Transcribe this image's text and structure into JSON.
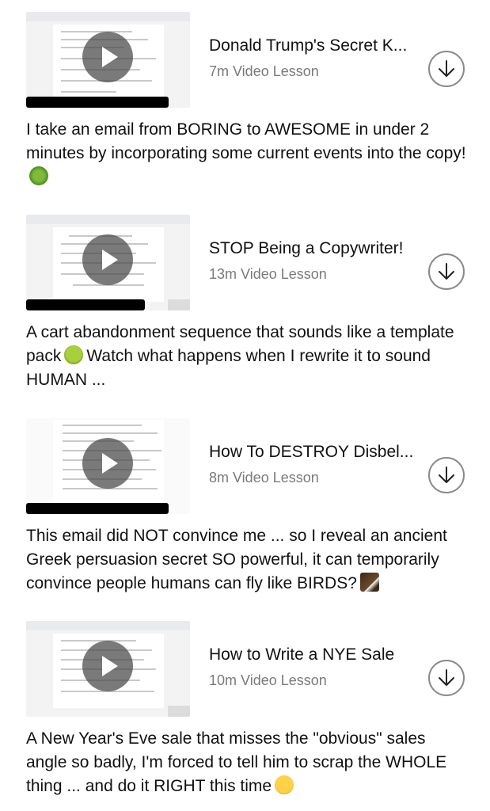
{
  "lessons": [
    {
      "title": "Donald Trump's Secret K...",
      "meta": "7m Video Lesson",
      "description": "I take an email from BORING to AWESOME in under 2 minutes by incorporating some current events into the copy!",
      "emoji_icon": "virus-icon"
    },
    {
      "title": "STOP Being a Copywriter!",
      "meta": "13m Video Lesson",
      "description_parts": [
        "A cart abandonment sequence that sounds like a template pack",
        "Watch what happens when I rewrite it to sound HUMAN ..."
      ],
      "emoji_icon": "nauseated-face-icon"
    },
    {
      "title": "How To DESTROY Disbel...",
      "meta": "8m Video Lesson",
      "description": "This email did NOT convince me ... so I reveal an ancient Greek persuasion secret SO powerful, it can temporarily convince people humans can fly like BIRDS?",
      "emoji_icon": "eagle-icon"
    },
    {
      "title": "How to Write a NYE Sale",
      "meta": "10m Video Lesson",
      "description": "A New Year's Eve sale that misses the \"obvious\" sales angle so badly, I'm forced to tell him to scrap the WHOLE thing ... and do it RIGHT this time",
      "emoji_icon": "angry-face-icon"
    }
  ]
}
